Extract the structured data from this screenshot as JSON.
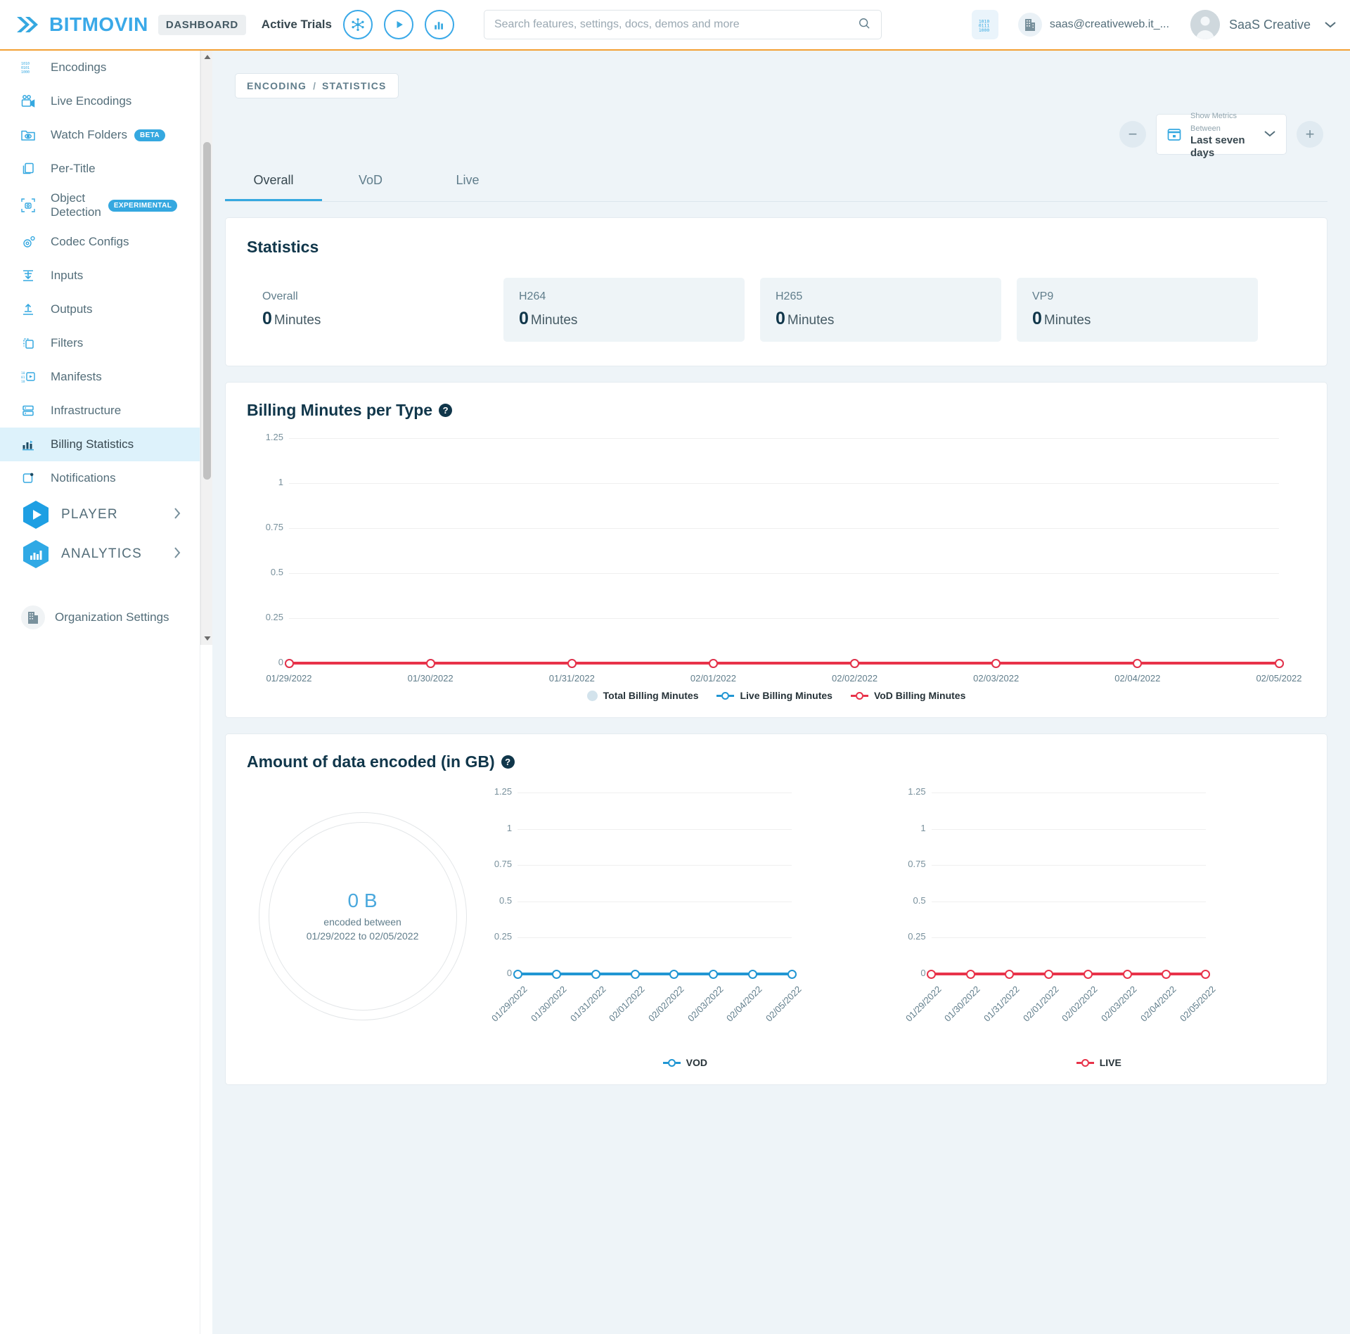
{
  "header": {
    "logo_text": "BITMOVIN",
    "logo_icon": "bitmovin-chevrons-icon",
    "dashboard_badge": "DASHBOARD",
    "active_trials": "Active Trials",
    "product_icons": [
      "encoding-nodes-icon",
      "player-play-icon",
      "analytics-bars-icon"
    ],
    "search": {
      "placeholder": "Search features, settings, docs, demos and more",
      "value": "",
      "icon": "search-icon"
    },
    "binary_icon": "binary-code-icon",
    "org_icon": "building-icon",
    "org_name": "saas@creativeweb.it_...",
    "user_name": "SaaS Creative",
    "user_chevron": "chevron-down-icon",
    "accent_color": "#35a8e0",
    "top_border_color": "#f3a034"
  },
  "sidebar": {
    "items": [
      {
        "label": "Encodings",
        "icon": "encodings-icon",
        "tag": "",
        "active": false
      },
      {
        "label": "Live Encodings",
        "icon": "live-camera-icon",
        "tag": "",
        "active": false
      },
      {
        "label": "Watch Folders",
        "icon": "watch-folder-eye-icon",
        "tag": "BETA",
        "active": false
      },
      {
        "label": "Per-Title",
        "icon": "per-title-layers-icon",
        "tag": "",
        "active": false
      },
      {
        "label": "Object Detection",
        "icon": "object-detection-icon",
        "tag": "EXPERIMENTAL",
        "active": false
      },
      {
        "label": "Codec Configs",
        "icon": "codec-gear-icon",
        "tag": "",
        "active": false
      },
      {
        "label": "Inputs",
        "icon": "inputs-download-icon",
        "tag": "",
        "active": false
      },
      {
        "label": "Outputs",
        "icon": "outputs-upload-icon",
        "tag": "",
        "active": false
      },
      {
        "label": "Filters",
        "icon": "filters-icon",
        "tag": "",
        "active": false
      },
      {
        "label": "Manifests",
        "icon": "manifests-icon",
        "tag": "",
        "active": false
      },
      {
        "label": "Infrastructure",
        "icon": "infrastructure-servers-icon",
        "tag": "",
        "active": false
      },
      {
        "label": "Billing Statistics",
        "icon": "billing-chart-icon",
        "tag": "",
        "active": true
      },
      {
        "label": "Notifications",
        "icon": "notifications-icon",
        "tag": "",
        "active": false
      }
    ],
    "groups": [
      {
        "label": "PLAYER",
        "icon": "player-hex-icon",
        "chevron": "chevron-right-icon"
      },
      {
        "label": "ANALYTICS",
        "icon": "analytics-hex-icon",
        "chevron": "chevron-right-icon"
      }
    ],
    "footer": {
      "label": "Organization Settings",
      "icon": "organization-building-icon"
    },
    "active_bg": "#ddf2fb"
  },
  "main": {
    "breadcrumb": {
      "first": "ENCODING",
      "separator": "/",
      "second": "STATISTICS"
    },
    "date_picker": {
      "minus_label": "−",
      "plus_label": "+",
      "calendar_icon": "calendar-icon",
      "caption": "Show Metrics Between",
      "value": "Last seven days",
      "chevron": "chevron-down-icon"
    },
    "tabs": [
      {
        "label": "Overall",
        "active": true
      },
      {
        "label": "VoD",
        "active": false
      },
      {
        "label": "Live",
        "active": false
      }
    ],
    "statistics": {
      "title": "Statistics",
      "boxes": [
        {
          "label": "Overall",
          "value": "0",
          "unit": "Minutes",
          "shaded": false
        },
        {
          "label": "H264",
          "value": "0",
          "unit": "Minutes",
          "shaded": true
        },
        {
          "label": "H265",
          "value": "0",
          "unit": "Minutes",
          "shaded": true
        },
        {
          "label": "VP9",
          "value": "0",
          "unit": "Minutes",
          "shaded": true
        }
      ]
    },
    "billing_card": {
      "title": "Billing Minutes per Type",
      "help_icon": "help-circle-icon"
    },
    "data_card": {
      "title": "Amount of data encoded (in GB)",
      "help_icon": "help-circle-icon",
      "donut": {
        "value": "0 B",
        "caption_line1": "encoded between",
        "caption_line2": "01/29/2022 to 02/05/2022"
      }
    }
  },
  "chart_data": [
    {
      "type": "line",
      "title": "Billing Minutes per Type",
      "categories": [
        "01/29/2022",
        "01/30/2022",
        "01/31/2022",
        "02/01/2022",
        "02/02/2022",
        "02/03/2022",
        "02/04/2022",
        "02/05/2022"
      ],
      "series": [
        {
          "name": "Total Billing Minutes",
          "values": [
            0,
            0,
            0,
            0,
            0,
            0,
            0,
            0
          ],
          "color": "#d3e3ec",
          "marker": "dot"
        },
        {
          "name": "Live Billing Minutes",
          "values": [
            0,
            0,
            0,
            0,
            0,
            0,
            0,
            0
          ],
          "color": "#2196d3",
          "marker": "ring"
        },
        {
          "name": "VoD Billing Minutes",
          "values": [
            0,
            0,
            0,
            0,
            0,
            0,
            0,
            0
          ],
          "color": "#e8334a",
          "marker": "ring"
        }
      ],
      "yticks": [
        "1.25",
        "1",
        "0.75",
        "0.5",
        "0.25",
        "0"
      ],
      "ylim": [
        0,
        1.25
      ],
      "xlabel": "",
      "ylabel": "",
      "grid": true,
      "legend": "bottom"
    },
    {
      "type": "line",
      "title": "VOD",
      "categories": [
        "01/29/2022",
        "01/30/2022",
        "01/31/2022",
        "02/01/2022",
        "02/02/2022",
        "02/03/2022",
        "02/04/2022",
        "02/05/2022"
      ],
      "series": [
        {
          "name": "VOD",
          "values": [
            0,
            0,
            0,
            0,
            0,
            0,
            0,
            0
          ],
          "color": "#2196d3",
          "marker": "ring"
        }
      ],
      "yticks": [
        "1.25",
        "1",
        "0.75",
        "0.5",
        "0.25",
        "0"
      ],
      "ylim": [
        0,
        1.25
      ],
      "grid": true,
      "legend": "bottom"
    },
    {
      "type": "line",
      "title": "LIVE",
      "categories": [
        "01/29/2022",
        "01/30/2022",
        "01/31/2022",
        "02/01/2022",
        "02/02/2022",
        "02/03/2022",
        "02/04/2022",
        "02/05/2022"
      ],
      "series": [
        {
          "name": "LIVE",
          "values": [
            0,
            0,
            0,
            0,
            0,
            0,
            0,
            0
          ],
          "color": "#e8334a",
          "marker": "ring"
        }
      ],
      "yticks": [
        "1.25",
        "1",
        "0.75",
        "0.5",
        "0.25",
        "0"
      ],
      "ylim": [
        0,
        1.25
      ],
      "grid": true,
      "legend": "bottom"
    },
    {
      "type": "pie",
      "title": "Amount of data encoded (in GB)",
      "labels": [
        "encoded"
      ],
      "values": [
        0
      ],
      "center_value": "0 B",
      "annotation": "encoded between 01/29/2022 to 02/05/2022"
    }
  ]
}
